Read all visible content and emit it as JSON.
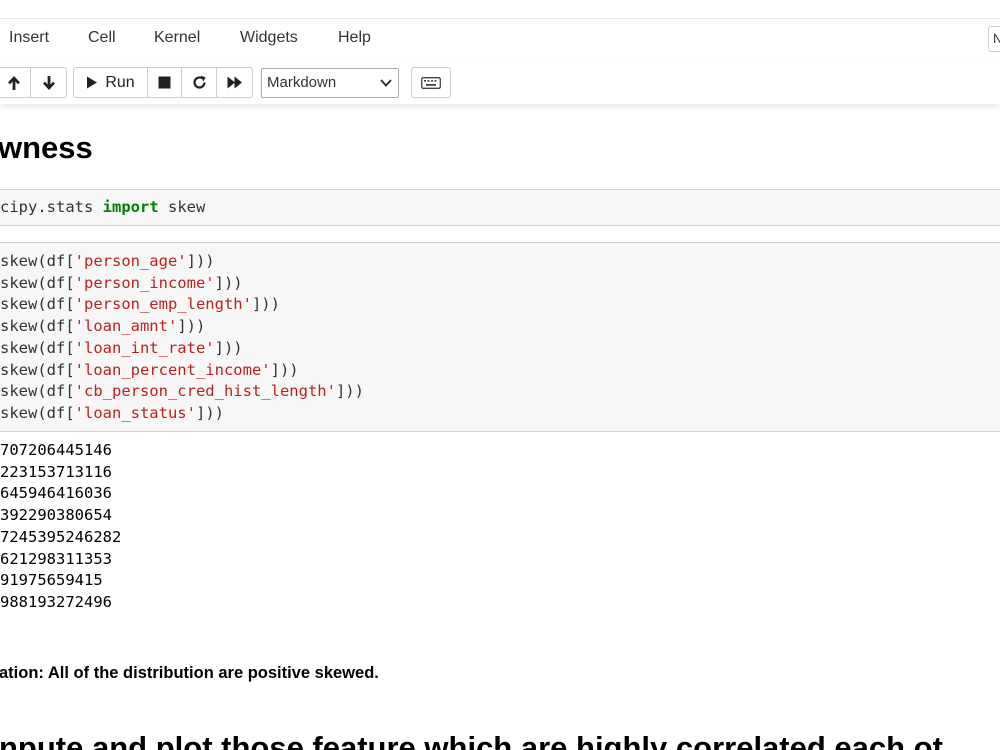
{
  "menu": {
    "items": [
      "Insert",
      "Cell",
      "Kernel",
      "Widgets",
      "Help"
    ],
    "kernel_indicator": "N"
  },
  "toolbar": {
    "run_label": "Run",
    "cell_type": "Markdown"
  },
  "notebook": {
    "heading": "wness",
    "import_cell": {
      "prefix": "cipy.stats ",
      "keyword": "import",
      "suffix": " skew"
    },
    "skew_cell": {
      "lines": [
        {
          "pre": "skew(df[",
          "str": "'person_age'",
          "post": "]))"
        },
        {
          "pre": "skew(df[",
          "str": "'person_income'",
          "post": "]))"
        },
        {
          "pre": "skew(df[",
          "str": "'person_emp_length'",
          "post": "]))"
        },
        {
          "pre": "skew(df[",
          "str": "'loan_amnt'",
          "post": "]))"
        },
        {
          "pre": "skew(df[",
          "str": "'loan_int_rate'",
          "post": "]))"
        },
        {
          "pre": "skew(df[",
          "str": "'loan_percent_income'",
          "post": "]))"
        },
        {
          "pre": "skew(df[",
          "str": "'cb_person_cred_hist_length'",
          "post": "]))"
        },
        {
          "pre": "skew(df[",
          "str": "'loan_status'",
          "post": "]))"
        }
      ]
    },
    "output_lines": [
      "707206445146",
      "223153713116",
      "645946416036",
      "392290380654",
      "7245395246282",
      "621298311353",
      "91975659415",
      "988193272496"
    ],
    "observation": "ation: All of the distribution are positive skewed.",
    "next_heading": "npute and plot those feature which are highly correlated each ot"
  }
}
